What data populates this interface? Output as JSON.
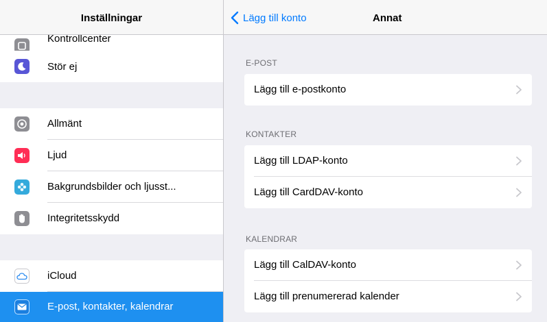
{
  "sidebar": {
    "title": "Inställningar",
    "items": [
      {
        "id": "kontroll",
        "label": "Kontrollcenter",
        "icon": "control-center-icon",
        "color": "#8e8e93"
      },
      {
        "id": "stor",
        "label": "Stör ej",
        "icon": "moon-icon",
        "color": "#5856d6"
      },
      {
        "id": "allmant",
        "label": "Allmänt",
        "icon": "gear-icon",
        "color": "#8e8e93"
      },
      {
        "id": "ljud",
        "label": "Ljud",
        "icon": "speaker-icon",
        "color": "#ff2d55"
      },
      {
        "id": "bakgrund",
        "label": "Bakgrundsbilder och ljusst...",
        "icon": "flower-icon",
        "color": "#34aadc"
      },
      {
        "id": "integritet",
        "label": "Integritetsskydd",
        "icon": "hand-icon",
        "color": "#8e8e93"
      },
      {
        "id": "icloud",
        "label": "iCloud",
        "icon": "cloud-icon",
        "color": "#ffffff"
      },
      {
        "id": "epost",
        "label": "E-post, kontakter, kalendrar",
        "icon": "mail-icon",
        "color": "#1e90f0",
        "selected": true
      }
    ]
  },
  "detail": {
    "back_label": "Lägg till konto",
    "title": "Annat",
    "sections": [
      {
        "header": "E-POST",
        "items": [
          "Lägg till e-postkonto"
        ]
      },
      {
        "header": "KONTAKTER",
        "items": [
          "Lägg till LDAP-konto",
          "Lägg till CardDAV-konto"
        ]
      },
      {
        "header": "KALENDRAR",
        "items": [
          "Lägg till CalDAV-konto",
          "Lägg till prenumererad kalender"
        ]
      }
    ]
  },
  "colors": {
    "accent": "#007aff",
    "selection": "#1e90f0",
    "background": "#efeff4"
  }
}
